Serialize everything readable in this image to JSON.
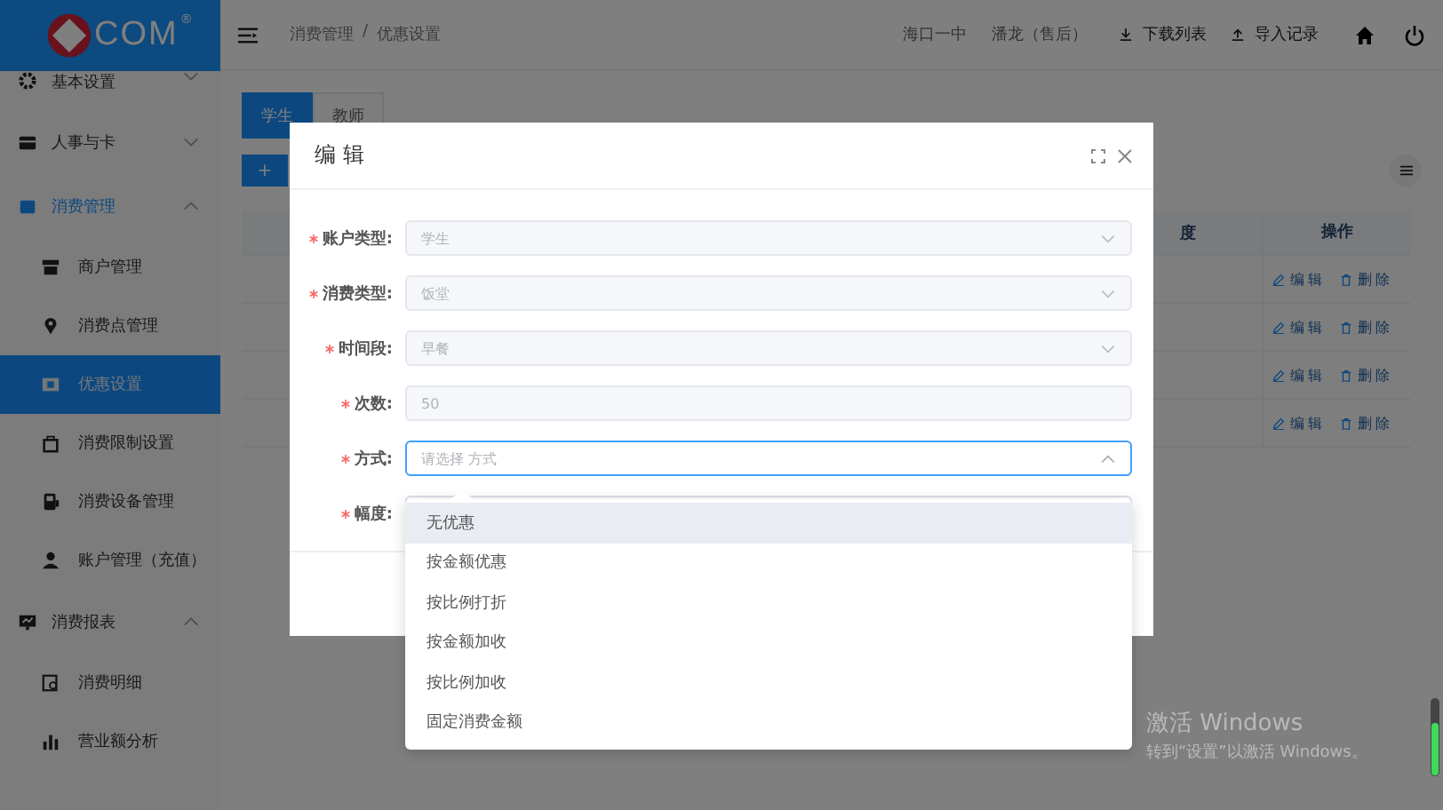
{
  "logo": {
    "text": "COM",
    "mark": "®"
  },
  "sidebar": {
    "items": [
      {
        "label": "基本设置",
        "expanded": false,
        "selected": false
      },
      {
        "label": "人事与卡",
        "expanded": false,
        "selected": false
      },
      {
        "label": "消费管理",
        "expanded": true,
        "selected": true,
        "children": [
          {
            "label": "商户管理",
            "selected": false
          },
          {
            "label": "消费点管理",
            "selected": false
          },
          {
            "label": "优惠设置",
            "selected": true
          },
          {
            "label": "消费限制设置",
            "selected": false
          },
          {
            "label": "消费设备管理",
            "selected": false
          },
          {
            "label": "账户管理（充值）",
            "selected": false
          }
        ]
      },
      {
        "label": "消费报表",
        "expanded": true,
        "selected": false,
        "children": [
          {
            "label": "消费明细",
            "selected": false
          },
          {
            "label": "营业额分析",
            "selected": false
          }
        ]
      }
    ]
  },
  "header": {
    "breadcrumb": [
      "消费管理",
      "优惠设置"
    ],
    "separator": "/",
    "school": "海口一中",
    "user": "潘龙（售后）",
    "actions": [
      "下载列表",
      "导入记录"
    ]
  },
  "tabs": [
    {
      "label": "学生",
      "selected": true
    },
    {
      "label": "教师",
      "selected": false
    }
  ],
  "add_button": "+",
  "table": {
    "columns": [
      "度",
      "操作"
    ],
    "rows": [
      {
        "actions": [
          "编辑",
          "删除"
        ]
      },
      {
        "actions": [
          "编辑",
          "删除"
        ]
      },
      {
        "actions": [
          "编辑",
          "删除"
        ]
      },
      {
        "actions": [
          "编辑",
          "删除"
        ]
      }
    ]
  },
  "dialog": {
    "title": "编 辑",
    "fields": [
      {
        "label": "账户类型:",
        "kind": "select",
        "value": "学生",
        "required": true,
        "disabled": true,
        "open": false
      },
      {
        "label": "消费类型:",
        "kind": "select",
        "value": "饭堂",
        "required": true,
        "disabled": true,
        "open": false
      },
      {
        "label": "时间段:",
        "kind": "select",
        "value": "早餐",
        "required": true,
        "disabled": true,
        "open": false
      },
      {
        "label": "次数:",
        "kind": "input",
        "value": "50",
        "required": true,
        "disabled": true
      },
      {
        "label": "方式:",
        "kind": "select",
        "placeholder": "请选择 方式",
        "required": true,
        "disabled": false,
        "open": true
      },
      {
        "label": "幅度:",
        "kind": "input",
        "required": true,
        "disabled": false
      }
    ],
    "options": [
      {
        "label": "无优惠",
        "selected": true
      },
      {
        "label": "按金额优惠",
        "selected": false
      },
      {
        "label": "按比例打折",
        "selected": false
      },
      {
        "label": "按金额加收",
        "selected": false
      },
      {
        "label": "按比例加收",
        "selected": false
      },
      {
        "label": "固定消费金额",
        "selected": false
      }
    ]
  },
  "activation": {
    "title": "激活 Windows",
    "subtitle": "转到“设置”以激活 Windows。"
  }
}
